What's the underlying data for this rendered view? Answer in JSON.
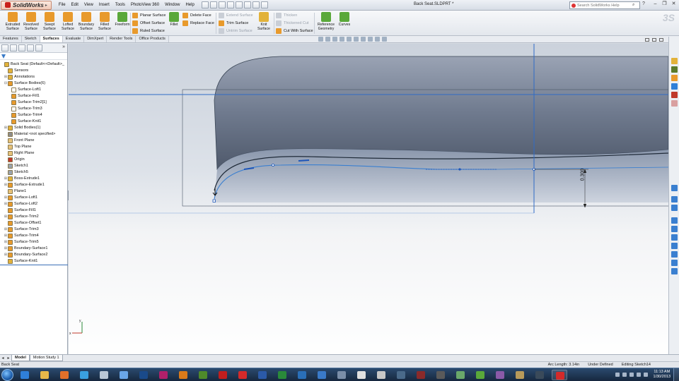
{
  "app": {
    "logo_text": "SolidWorks",
    "document_title": "Back Seat.SLDPRT *",
    "menus": [
      "File",
      "Edit",
      "View",
      "Insert",
      "Tools",
      "PhotoView 360",
      "Window",
      "Help"
    ],
    "search_placeholder": "Search SolidWorks Help",
    "accent": "#c8201a"
  },
  "ribbon": {
    "big_buttons": [
      {
        "label": "Extruded Surface",
        "icon": "extruded-surface-icon",
        "color": "#e89a2c"
      },
      {
        "label": "Revolved Surface",
        "icon": "revolved-surface-icon",
        "color": "#e89a2c"
      },
      {
        "label": "Swept Surface",
        "icon": "swept-surface-icon",
        "color": "#e89a2c"
      },
      {
        "label": "Lofted Surface",
        "icon": "lofted-surface-icon",
        "color": "#e89a2c"
      },
      {
        "label": "Boundary Surface",
        "icon": "boundary-surface-icon",
        "color": "#e89a2c"
      },
      {
        "label": "Filled Surface",
        "icon": "filled-surface-icon",
        "color": "#e89a2c"
      },
      {
        "label": "Freeform",
        "icon": "freeform-icon",
        "color": "#5aa83a"
      }
    ],
    "col1": [
      {
        "label": "Planar Surface",
        "icon": "planar-surface-icon",
        "disabled": false
      },
      {
        "label": "Offset Surface",
        "icon": "offset-surface-icon",
        "disabled": false
      },
      {
        "label": "Ruled Surface",
        "icon": "ruled-surface-icon",
        "disabled": false
      }
    ],
    "fillet_label": "Fillet",
    "col2": [
      {
        "label": "Delete Face",
        "icon": "delete-face-icon",
        "disabled": false
      },
      {
        "label": "Replace Face",
        "icon": "replace-face-icon",
        "disabled": false
      }
    ],
    "col3": [
      {
        "label": "Extend Surface",
        "icon": "extend-surface-icon",
        "disabled": true
      },
      {
        "label": "Trim Surface",
        "icon": "trim-surface-icon",
        "disabled": false
      },
      {
        "label": "Untrim Surface",
        "icon": "untrim-surface-icon",
        "disabled": true
      }
    ],
    "knit_label": "Knit Surface",
    "col4": [
      {
        "label": "Thicken",
        "icon": "thicken-icon",
        "disabled": true
      },
      {
        "label": "Thickened Cut",
        "icon": "thickened-cut-icon",
        "disabled": true
      },
      {
        "label": "Cut With Surface",
        "icon": "cut-with-surface-icon",
        "disabled": false
      }
    ],
    "reference_geometry_label": "Reference Geometry",
    "curves_label": "Curves"
  },
  "command_tabs": [
    {
      "label": "Features",
      "active": false
    },
    {
      "label": "Sketch",
      "active": false
    },
    {
      "label": "Surfaces",
      "active": true
    },
    {
      "label": "Evaluate",
      "active": false
    },
    {
      "label": "DimXpert",
      "active": false
    },
    {
      "label": "Render Tools",
      "active": false
    },
    {
      "label": "Office Products",
      "active": false
    }
  ],
  "feature_tree": [
    {
      "label": "Back Seat  (Default<<Default>_",
      "indent": 0,
      "expander": "",
      "icon": "part-icon",
      "color": "#e2b23a"
    },
    {
      "label": "Sensors",
      "indent": 1,
      "expander": "",
      "icon": "sensor-icon",
      "color": "#e2b23a"
    },
    {
      "label": "Annotations",
      "indent": 1,
      "expander": "+",
      "icon": "annotations-icon",
      "color": "#e2b23a"
    },
    {
      "label": "Surface Bodies(6)",
      "indent": 1,
      "expander": "-",
      "icon": "surface-bodies-icon",
      "color": "#e89a2c"
    },
    {
      "label": "Surface-Loft1",
      "indent": 2,
      "expander": "",
      "icon": "surface-body-icon",
      "color": "#ffffff"
    },
    {
      "label": "Surface-Fill1",
      "indent": 2,
      "expander": "",
      "icon": "surface-body-icon",
      "color": "#e89a2c"
    },
    {
      "label": "Surface-Trim2[1]",
      "indent": 2,
      "expander": "",
      "icon": "surface-body-icon",
      "color": "#e89a2c"
    },
    {
      "label": "Surface-Trim3",
      "indent": 2,
      "expander": "",
      "icon": "surface-body-icon",
      "color": "#ffffff"
    },
    {
      "label": "Surface-Trim4",
      "indent": 2,
      "expander": "",
      "icon": "surface-body-icon",
      "color": "#e89a2c"
    },
    {
      "label": "Surface-Knit1",
      "indent": 2,
      "expander": "",
      "icon": "surface-body-icon",
      "color": "#e89a2c"
    },
    {
      "label": "Solid Bodies(1)",
      "indent": 1,
      "expander": "+",
      "icon": "solid-bodies-icon",
      "color": "#e2b23a"
    },
    {
      "label": "Material <not specified>",
      "indent": 1,
      "expander": "",
      "icon": "material-icon",
      "color": "#8c8c8c"
    },
    {
      "label": "Front Plane",
      "indent": 1,
      "expander": "",
      "icon": "plane-icon",
      "color": "#e6c27a"
    },
    {
      "label": "Top Plane",
      "indent": 1,
      "expander": "",
      "icon": "plane-icon",
      "color": "#e6c27a"
    },
    {
      "label": "Right Plane",
      "indent": 1,
      "expander": "",
      "icon": "plane-icon",
      "color": "#e6c27a"
    },
    {
      "label": "Origin",
      "indent": 1,
      "expander": "",
      "icon": "origin-icon",
      "color": "#c0392b"
    },
    {
      "label": "Sketch1",
      "indent": 1,
      "expander": "",
      "icon": "sketch-icon",
      "color": "#9aa3ad"
    },
    {
      "label": "Sketch5",
      "indent": 1,
      "expander": "",
      "icon": "sketch-icon",
      "color": "#9aa3ad"
    },
    {
      "label": "Boss-Extrude1",
      "indent": 1,
      "expander": "+",
      "icon": "boss-extrude-icon",
      "color": "#e2b23a"
    },
    {
      "label": "Surface-Extrude1",
      "indent": 1,
      "expander": "+",
      "icon": "surface-extrude-icon",
      "color": "#e89a2c"
    },
    {
      "label": "Plane1",
      "indent": 1,
      "expander": "",
      "icon": "plane-icon",
      "color": "#e6c27a"
    },
    {
      "label": "Surface-Loft1",
      "indent": 1,
      "expander": "+",
      "icon": "surface-loft-icon",
      "color": "#e89a2c"
    },
    {
      "label": "Surface-Loft2",
      "indent": 1,
      "expander": "+",
      "icon": "surface-loft-icon",
      "color": "#e89a2c"
    },
    {
      "label": "Surface-Fill1",
      "indent": 1,
      "expander": "",
      "icon": "surface-fill-icon",
      "color": "#e89a2c"
    },
    {
      "label": "Surface-Trim2",
      "indent": 1,
      "expander": "+",
      "icon": "surface-trim-icon",
      "color": "#e89a2c"
    },
    {
      "label": "Surface-Offset1",
      "indent": 1,
      "expander": "",
      "icon": "surface-offset-icon",
      "color": "#e89a2c"
    },
    {
      "label": "Surface-Trim3",
      "indent": 1,
      "expander": "+",
      "icon": "surface-trim-icon",
      "color": "#e89a2c"
    },
    {
      "label": "Surface-Trim4",
      "indent": 1,
      "expander": "+",
      "icon": "surface-trim-icon",
      "color": "#e89a2c"
    },
    {
      "label": "Surface-Trim5",
      "indent": 1,
      "expander": "+",
      "icon": "surface-trim-icon",
      "color": "#e89a2c"
    },
    {
      "label": "Boundary-Surface1",
      "indent": 1,
      "expander": "+",
      "icon": "boundary-surface-icon",
      "color": "#e89a2c"
    },
    {
      "label": "Boundary-Surface2",
      "indent": 1,
      "expander": "+",
      "icon": "boundary-surface-icon",
      "color": "#e89a2c"
    },
    {
      "label": "Surface-Knit1",
      "indent": 1,
      "expander": "",
      "icon": "surface-knit-icon",
      "color": "#e2b23a"
    }
  ],
  "viewport": {
    "dimension_value": "0.300",
    "sketch_color": "#3a7fd0",
    "surface_color": "#5d6a80"
  },
  "bottom_tabs": [
    {
      "label": "Model",
      "active": true
    },
    {
      "label": "Motion Study 1",
      "active": false
    }
  ],
  "status": {
    "left": "Back Seat",
    "arc_length": "Arc Length: 3.14in",
    "definition": "Under Defined",
    "mode": "Editing Sketch14"
  },
  "taskbar": {
    "apps": [
      {
        "icon": "ie-icon",
        "color": "#2f7fd8",
        "open": false
      },
      {
        "icon": "explorer-icon",
        "color": "#e6b74a",
        "open": false
      },
      {
        "icon": "firefox-icon",
        "color": "#e2702a",
        "open": false
      },
      {
        "icon": "skype-icon",
        "color": "#3aa0e0",
        "open": false
      },
      {
        "icon": "calculator-icon",
        "color": "#b9c7d6",
        "open": false
      },
      {
        "icon": "itunes-icon",
        "color": "#6aa6e8",
        "open": false
      },
      {
        "icon": "photoshop-icon",
        "color": "#1a4a8a",
        "open": false
      },
      {
        "icon": "indesign-icon",
        "color": "#b0206a",
        "open": false
      },
      {
        "icon": "illustrator-icon",
        "color": "#d97a1a",
        "open": false
      },
      {
        "icon": "dreamweaver-icon",
        "color": "#4f8a2a",
        "open": false
      },
      {
        "icon": "acrobat-icon",
        "color": "#c01e1e",
        "open": false
      },
      {
        "icon": "solidworks-icon",
        "color": "#d42a2a",
        "open": false
      },
      {
        "icon": "word-icon",
        "color": "#2b5aa8",
        "open": false
      },
      {
        "icon": "excel-icon",
        "color": "#2a8a3a",
        "open": false
      },
      {
        "icon": "sketchup-icon",
        "color": "#2a6fb8",
        "open": false
      },
      {
        "icon": "java-icon",
        "color": "#3a7ac8",
        "open": false
      },
      {
        "icon": "network-icon",
        "color": "#7a8ea8",
        "open": false
      },
      {
        "icon": "cube-icon",
        "color": "#e0e0e0",
        "open": false
      },
      {
        "icon": "game-icon",
        "color": "#c8c8c8",
        "open": false
      },
      {
        "icon": "fish-icon",
        "color": "#4a6a8a",
        "open": false
      },
      {
        "icon": "car-icon",
        "color": "#8a2a2a",
        "open": false
      },
      {
        "icon": "glasses-icon",
        "color": "#5a5a5a",
        "open": false
      },
      {
        "icon": "character-icon",
        "color": "#6aa86a",
        "open": false
      },
      {
        "icon": "monster-icon",
        "color": "#5aa83a",
        "open": false
      },
      {
        "icon": "alien-icon",
        "color": "#8a5aa8",
        "open": false
      },
      {
        "icon": "civ-icon",
        "color": "#b89a5a",
        "open": false
      },
      {
        "icon": "steam-icon",
        "color": "#3a4a5a",
        "open": false
      },
      {
        "icon": "solidworks-running-icon",
        "color": "#d42a2a",
        "open": true
      }
    ],
    "clock_time": "11:13 AM",
    "clock_date": "1/30/2013"
  }
}
